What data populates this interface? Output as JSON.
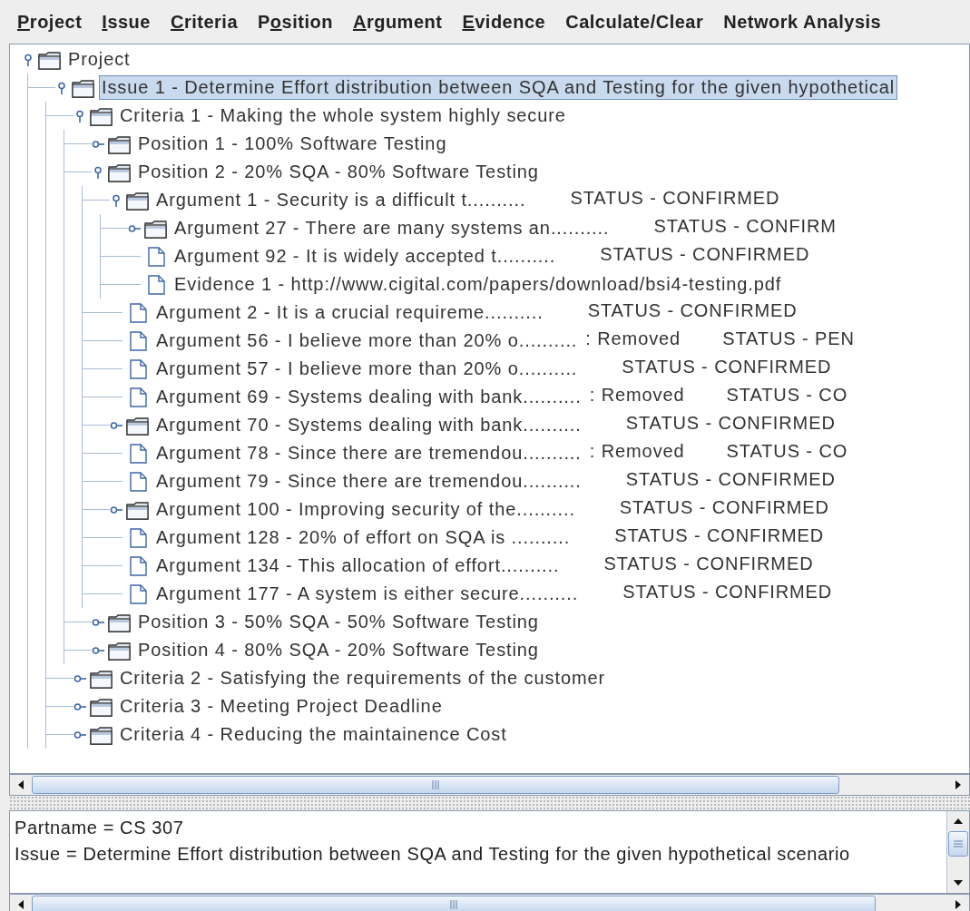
{
  "menu": [
    {
      "key": "P",
      "after": "roject"
    },
    {
      "key": "I",
      "after": "ssue"
    },
    {
      "key": "C",
      "after": "riteria"
    },
    {
      "before": "P",
      "key": "o",
      "after": "sition"
    },
    {
      "key": "A",
      "after": "rgument"
    },
    {
      "key": "E",
      "after": "vidence"
    },
    {
      "before": "Calculate/Clear"
    },
    {
      "before": "Network Analysis"
    }
  ],
  "tree": [
    {
      "kind": "folder",
      "label": "Project",
      "expanded": true,
      "selected": false,
      "children": [
        {
          "kind": "folder",
          "label": "Issue 1 - Determine Effort distribution between SQA and Testing for the given hypothetical",
          "expanded": true,
          "selected": true,
          "children": [
            {
              "kind": "folder",
              "label": "Criteria 1 - Making the whole system highly secure",
              "expanded": true,
              "selected": false,
              "children": [
                {
                  "kind": "folder",
                  "label": "Position 1 - 100% Software Testing",
                  "expanded": false,
                  "selected": false
                },
                {
                  "kind": "folder",
                  "label": "Position 2 - 20% SQA - 80% Software Testing",
                  "expanded": true,
                  "selected": false,
                  "children": [
                    {
                      "kind": "folder",
                      "label": "Argument 1 - Security is a difficult t..........",
                      "status": "STATUS - CONFIRMED",
                      "expanded": true,
                      "selected": false,
                      "children": [
                        {
                          "kind": "folder",
                          "label": "Argument 27 - There are many systems an..........",
                          "status": "STATUS - CONFIRM",
                          "expanded": false,
                          "selected": false
                        },
                        {
                          "kind": "file",
                          "label": "Argument 92 -  It is widely accepted t..........",
                          "status": "STATUS - CONFIRMED",
                          "selected": false
                        },
                        {
                          "kind": "file",
                          "label": "Evidence 1 - http://www.cigital.com/papers/download/bsi4-testing.pdf",
                          "selected": false
                        }
                      ]
                    },
                    {
                      "kind": "file",
                      "label": "Argument 2 - It is a crucial requireme..........",
                      "status": "STATUS - CONFIRMED",
                      "selected": false
                    },
                    {
                      "kind": "file",
                      "label": "Argument 56 - I believe more than 20% o..........",
                      "note": ": Removed",
                      "status": "STATUS - PEN",
                      "selected": false
                    },
                    {
                      "kind": "file",
                      "label": "Argument 57 - I believe more than 20% o..........",
                      "status": "STATUS - CONFIRMED",
                      "selected": false
                    },
                    {
                      "kind": "file",
                      "label": "Argument 69 - Systems dealing with bank..........",
                      "note": ": Removed",
                      "status": "STATUS - CO",
                      "selected": false
                    },
                    {
                      "kind": "folder",
                      "label": "Argument 70 - Systems dealing with bank..........",
                      "status": "STATUS - CONFIRMED",
                      "expanded": false,
                      "selected": false
                    },
                    {
                      "kind": "file",
                      "label": "Argument 78 - Since there are tremendou..........",
                      "note": ": Removed",
                      "status": "STATUS - CO",
                      "selected": false
                    },
                    {
                      "kind": "file",
                      "label": "Argument 79 - Since there are tremendou..........",
                      "status": "STATUS - CONFIRMED",
                      "selected": false
                    },
                    {
                      "kind": "folder",
                      "label": "Argument 100 - Improving security of the..........",
                      "status": "STATUS - CONFIRMED",
                      "expanded": false,
                      "selected": false
                    },
                    {
                      "kind": "file",
                      "label": "Argument 128 -  20% of effort on SQA is ..........",
                      "status": "STATUS - CONFIRMED",
                      "selected": false
                    },
                    {
                      "kind": "file",
                      "label": "Argument 134 - This allocation of effort..........",
                      "status": "STATUS - CONFIRMED",
                      "selected": false
                    },
                    {
                      "kind": "file",
                      "label": "Argument 177 - A system is either secure..........",
                      "status": "STATUS - CONFIRMED",
                      "selected": false
                    }
                  ]
                },
                {
                  "kind": "folder",
                  "label": "Position 3 - 50% SQA - 50% Software Testing",
                  "expanded": false,
                  "selected": false
                },
                {
                  "kind": "folder",
                  "label": "Position 4 - 80% SQA - 20% Software Testing",
                  "expanded": false,
                  "selected": false
                }
              ]
            },
            {
              "kind": "folder",
              "label": "Criteria 2 - Satisfying the requirements of the customer",
              "expanded": false,
              "selected": false
            },
            {
              "kind": "folder",
              "label": "Criteria 3 - Meeting Project Deadline",
              "expanded": false,
              "selected": false
            },
            {
              "kind": "folder",
              "label": "Criteria 4 - Reducing the maintainence Cost",
              "expanded": false,
              "selected": false
            }
          ]
        }
      ]
    }
  ],
  "details": [
    "Partname = CS 307",
    "Issue = Determine Effort distribution between SQA and Testing for the given hypothetical scenario"
  ]
}
